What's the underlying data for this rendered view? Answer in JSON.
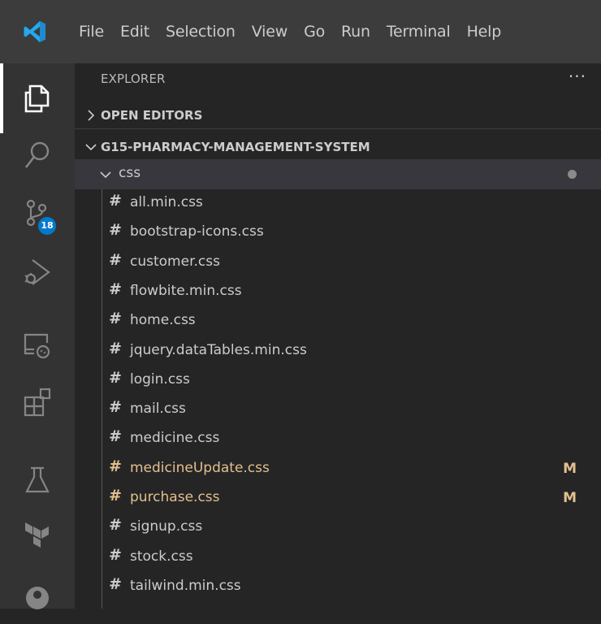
{
  "menu": [
    "File",
    "Edit",
    "Selection",
    "View",
    "Go",
    "Run",
    "Terminal",
    "Help"
  ],
  "activity_bar": {
    "scm_badge": "18",
    "icons": [
      "explorer-icon",
      "search-icon",
      "source-control-icon",
      "run-debug-icon",
      "remote-explorer-icon",
      "extensions-icon",
      "testing-icon",
      "terraform-icon",
      "accounts-icon"
    ]
  },
  "explorer": {
    "title": "EXPLORER",
    "more": "···",
    "open_editors": "OPEN EDITORS",
    "workspace": "G15-PHARMACY-MANAGEMENT-SYSTEM",
    "folder": "css",
    "files": [
      {
        "name": "all.min.css",
        "status": ""
      },
      {
        "name": "bootstrap-icons.css",
        "status": ""
      },
      {
        "name": "customer.css",
        "status": ""
      },
      {
        "name": "flowbite.min.css",
        "status": ""
      },
      {
        "name": "home.css",
        "status": ""
      },
      {
        "name": "jquery.dataTables.min.css",
        "status": ""
      },
      {
        "name": "login.css",
        "status": ""
      },
      {
        "name": "mail.css",
        "status": ""
      },
      {
        "name": "medicine.css",
        "status": ""
      },
      {
        "name": "medicineUpdate.css",
        "status": "M"
      },
      {
        "name": "purchase.css",
        "status": "M"
      },
      {
        "name": "signup.css",
        "status": ""
      },
      {
        "name": "stock.css",
        "status": ""
      },
      {
        "name": "tailwind.min.css",
        "status": ""
      }
    ],
    "hash_glyph": "#"
  },
  "colors": {
    "accent": "#007acc",
    "modified": "#e2c08d",
    "titlebar": "#3c3c3c",
    "activitybar": "#333333",
    "sidebar": "#252526"
  }
}
